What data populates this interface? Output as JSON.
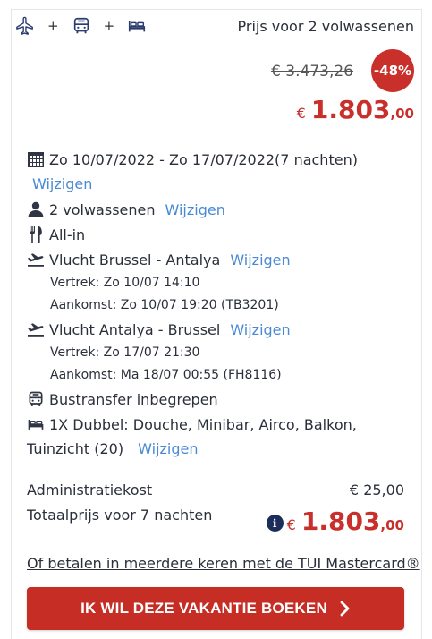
{
  "header": {
    "icons": [
      "plane-icon",
      "bus-icon",
      "bed-icon"
    ],
    "plus": "+",
    "price_for": "Prijs voor 2 volwassenen"
  },
  "pricing": {
    "old_price": "€ 3.473,26",
    "discount": "-48%",
    "currency": "€",
    "price_int": "1.803",
    "price_dec": ",00"
  },
  "details": {
    "dates": "Zo 10/07/2022 - Zo 17/07/2022(7 nachten)",
    "change_label": "Wijzigen",
    "travellers": "2 volwassenen",
    "board": "All-in",
    "outbound": {
      "title": "Vlucht Brussel - Antalya",
      "departure": "Vertrek: Zo 10/07 14:10",
      "arrival": "Aankomst: Zo 10/07 19:20 (TB3201)"
    },
    "return": {
      "title": "Vlucht Antalya - Brussel",
      "departure": "Vertrek: Zo 17/07 21:30",
      "arrival": "Aankomst: Ma 18/07 00:55 (FH8116)"
    },
    "transfer": "Bustransfer inbegrepen",
    "room_line1": "1X Dubbel: Douche, Minibar, Airco, Balkon,",
    "room_line2": "Tuinzicht (20)"
  },
  "summary": {
    "admin_label": "Administratiekost",
    "admin_value": "€ 25,00",
    "total_label": "Totaalprijs voor 7 nachten",
    "info": "i",
    "currency": "€",
    "total_int": "1.803",
    "total_dec": ",00"
  },
  "mastercard_link": "Of betalen in meerdere keren met de TUI Mastercard®",
  "book_button": "IK WIL DEZE VAKANTIE BOEKEN",
  "colors": {
    "accent_red": "#c9302c",
    "link_blue": "#4a8ad4",
    "info_navy": "#1c2d5a"
  }
}
